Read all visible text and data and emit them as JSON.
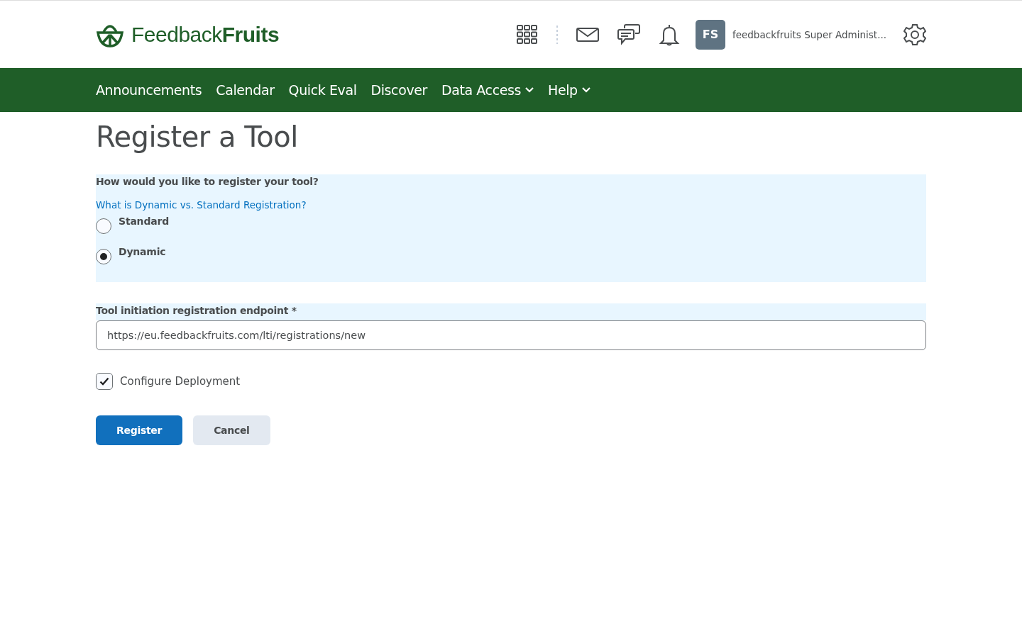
{
  "header": {
    "logo": "Feedback**Fruits**",
    "avatar_initials": "FS",
    "user_name": "feedbackfruits Super Administ..."
  },
  "nav": [
    {
      "label": "Announcements",
      "has_menu": false
    },
    {
      "label": "Calendar",
      "has_menu": false
    },
    {
      "label": "Quick Eval",
      "has_menu": false
    },
    {
      "label": "Discover",
      "has_menu": false
    },
    {
      "label": "Data Access",
      "has_menu": true
    },
    {
      "label": "Help",
      "has_menu": true
    }
  ],
  "page_title": "Register a Tool",
  "registration": {
    "question": "How would you like to register your tool?",
    "help_link": "What is Dynamic vs. Standard Registration?",
    "options": [
      {
        "label": "Standard",
        "selected": false
      },
      {
        "label": "Dynamic",
        "selected": true
      }
    ]
  },
  "endpoint": {
    "label": "Tool initiation registration endpoint *",
    "value": "https://eu.feedbackfruits.com/lti/registrations/new"
  },
  "configure_deployment": {
    "label": "Configure Deployment",
    "checked": true
  },
  "buttons": [
    {
      "label": "Register",
      "kind": "primary"
    },
    {
      "label": "Cancel",
      "kind": "secondary"
    }
  ]
}
